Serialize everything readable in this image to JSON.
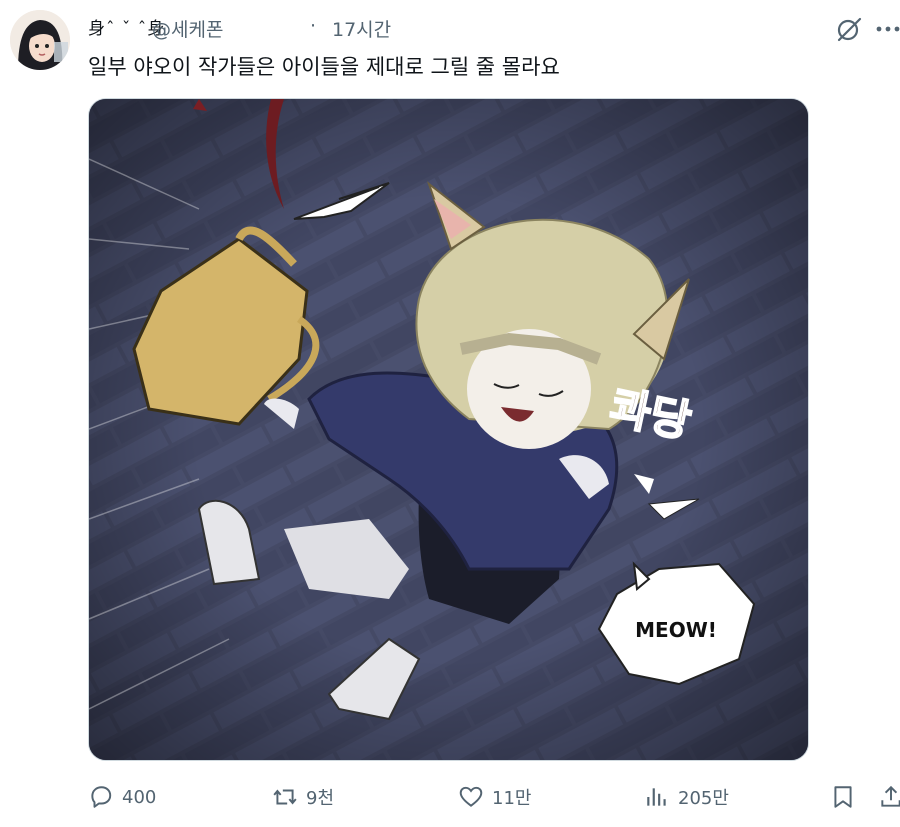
{
  "tweet": {
    "display_name": "⾝ˆ ˇ ˆ⾝",
    "handle": "@세케폰",
    "separator": "·",
    "time": "17시간",
    "text": "일부 야오이 작가들은 아이들을 제대로 그릴 줄 몰라요"
  },
  "media": {
    "sfx_text": "콰당",
    "bubble_text": "MEOW!"
  },
  "actions": {
    "reply_count": "400",
    "repost_count": "9천",
    "like_count": "11만",
    "view_count": "205만"
  },
  "icons": {
    "grok": "grok-icon",
    "more": "more-dots-icon",
    "reply": "speech-bubble-icon",
    "repost": "repost-arrows-icon",
    "like": "heart-icon",
    "views": "bar-chart-icon",
    "bookmark": "bookmark-icon",
    "share": "share-upload-icon"
  },
  "colors": {
    "text": "#0f1419",
    "muted": "#536471"
  }
}
